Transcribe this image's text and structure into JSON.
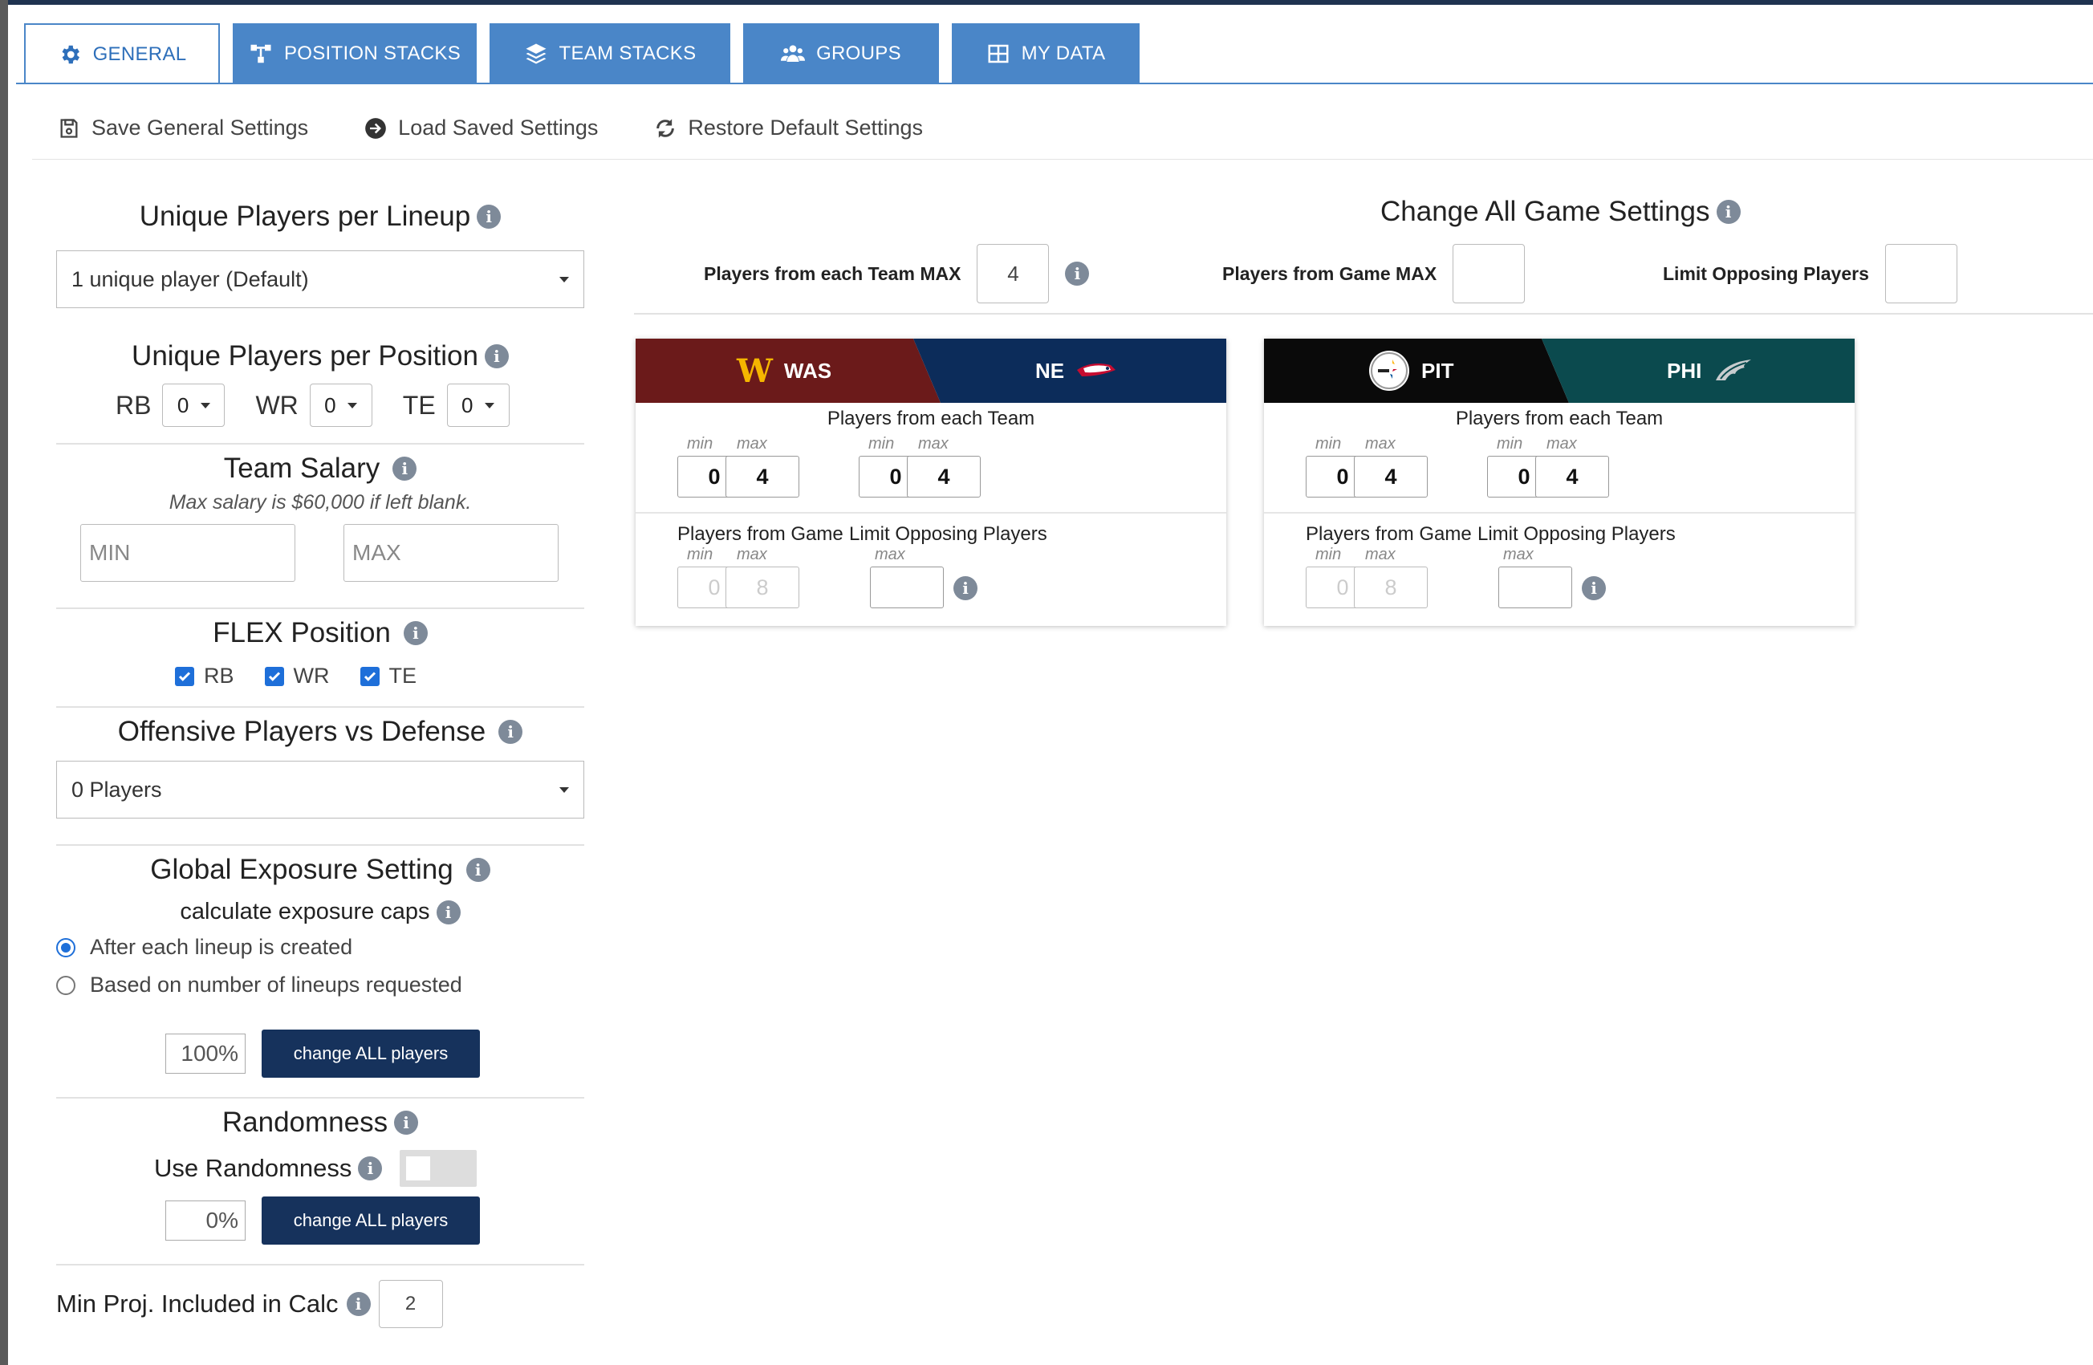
{
  "tabs": [
    {
      "label": "GENERAL",
      "icon": "gear-icon",
      "active": true
    },
    {
      "label": "POSITION STACKS",
      "icon": "hierarchy-icon"
    },
    {
      "label": "TEAM STACKS",
      "icon": "layers-icon"
    },
    {
      "label": "GROUPS",
      "icon": "users-icon"
    },
    {
      "label": "MY DATA",
      "icon": "table-icon"
    }
  ],
  "actions": {
    "save": "Save General Settings",
    "load": "Load Saved Settings",
    "restore": "Restore Default Settings"
  },
  "left": {
    "unique_lineup": {
      "title": "Unique Players per Lineup",
      "value": "1 unique player (Default)"
    },
    "unique_position": {
      "title": "Unique Players per Position",
      "rb_label": "RB",
      "rb": "0",
      "wr_label": "WR",
      "wr": "0",
      "te_label": "TE",
      "te": "0"
    },
    "team_salary": {
      "title": "Team Salary",
      "hint": "Max salary is $60,000 if left blank.",
      "min_placeholder": "MIN",
      "max_placeholder": "MAX"
    },
    "flex": {
      "title": "FLEX Position",
      "rb": "RB",
      "wr": "WR",
      "te": "TE"
    },
    "offense_vs_def": {
      "title": "Offensive Players vs Defense",
      "value": "0 Players"
    },
    "exposure": {
      "title": "Global Exposure Setting",
      "subtitle": "calculate exposure caps",
      "option1": "After each lineup is created",
      "option2": "Based on number of lineups requested",
      "pct": "100%",
      "button": "change ALL players"
    },
    "randomness": {
      "title": "Randomness",
      "use_label": "Use Randomness",
      "pct": "0%",
      "button": "change ALL players"
    },
    "min_proj": {
      "title": "Min Proj. Included in Calc",
      "value": "2"
    }
  },
  "change_all": {
    "title": "Change All Game Settings",
    "team_max_label": "Players from each Team MAX",
    "team_max_value": "4",
    "game_max_label": "Players from Game MAX",
    "game_max_value": "",
    "limit_opp_label": "Limit Opposing Players",
    "limit_opp_value": ""
  },
  "games": [
    {
      "away": {
        "abbr": "WAS",
        "color": "#6b1a1a",
        "logo": "W"
      },
      "home": {
        "abbr": "NE",
        "color": "#0c2c5a"
      },
      "team_sub": "Players from each Team",
      "min_label": "min",
      "max_label": "max",
      "away_min": "0",
      "away_max": "4",
      "home_min": "0",
      "home_max": "4",
      "game_label": "Players from Game",
      "game_min": "0",
      "game_max": "8",
      "opp_label": "Limit Opposing Players",
      "opp_max": ""
    },
    {
      "away": {
        "abbr": "PIT",
        "color": "#0a0a0a"
      },
      "home": {
        "abbr": "PHI",
        "color": "#0b4a4e"
      },
      "team_sub": "Players from each Team",
      "min_label": "min",
      "max_label": "max",
      "away_min": "0",
      "away_max": "4",
      "home_min": "0",
      "home_max": "4",
      "game_label": "Players from Game",
      "game_min": "0",
      "game_max": "8",
      "opp_label": "Limit Opposing Players",
      "opp_max": ""
    }
  ]
}
